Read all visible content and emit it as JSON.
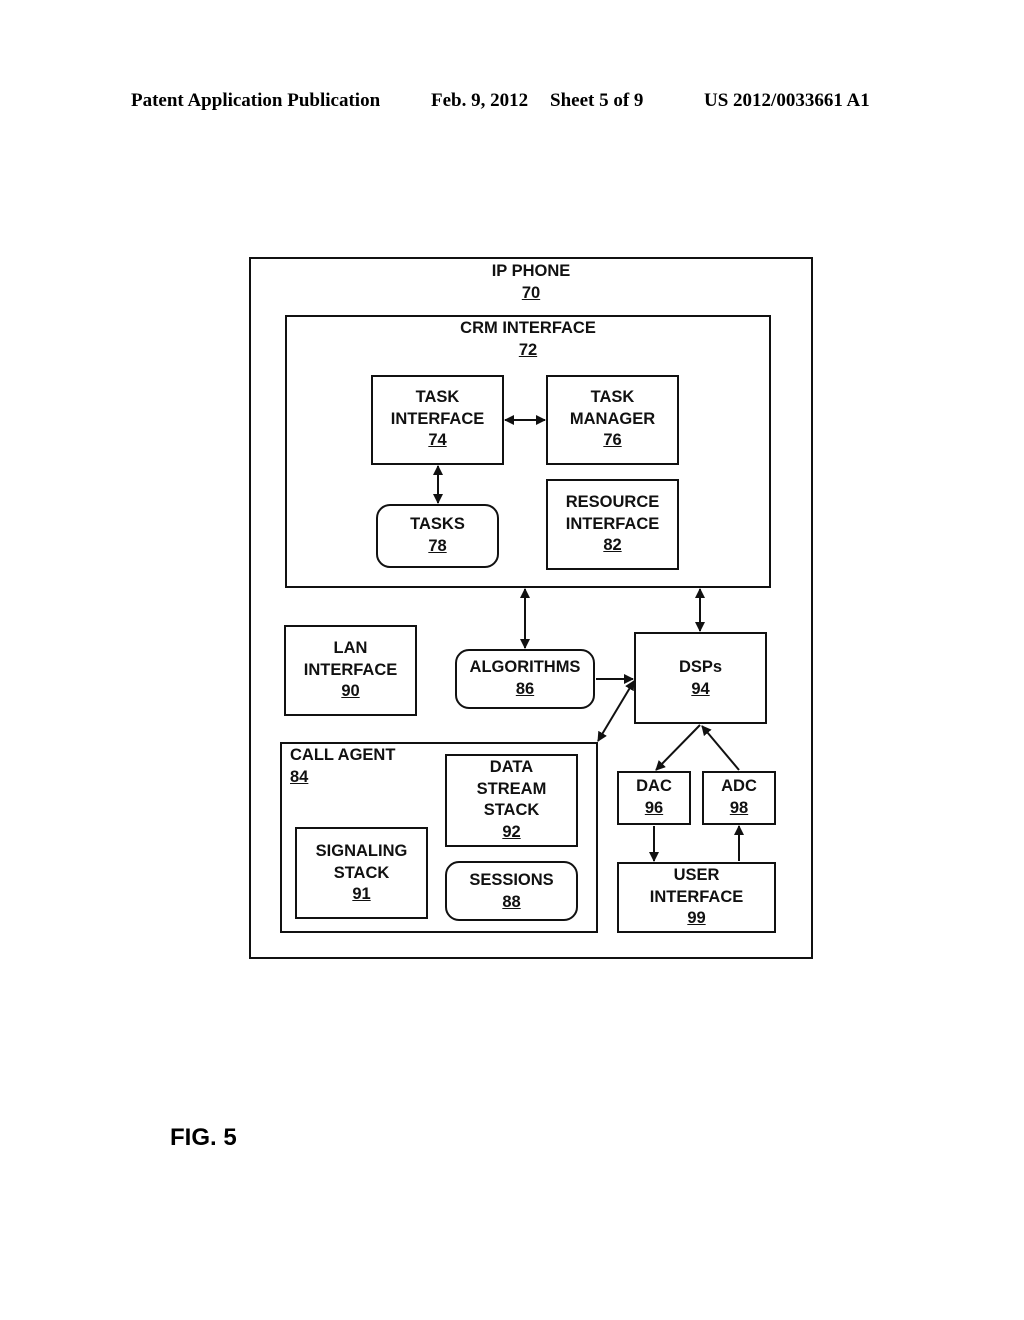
{
  "header": {
    "publication": "Patent Application Publication",
    "date": "Feb. 9, 2012",
    "sheet": "Sheet 5 of 9",
    "number": "US 2012/0033661 A1"
  },
  "figure_label": "FIG. 5",
  "blocks": {
    "ip_phone": {
      "title": "IP PHONE",
      "ref": "70"
    },
    "crm_interface": {
      "title": "CRM INTERFACE",
      "ref": "72"
    },
    "task_interface": {
      "line1": "TASK",
      "line2": "INTERFACE",
      "ref": "74"
    },
    "task_manager": {
      "line1": "TASK",
      "line2": "MANAGER",
      "ref": "76"
    },
    "tasks": {
      "title": "TASKS",
      "ref": "78"
    },
    "resource_interface": {
      "line1": "RESOURCE",
      "line2": "INTERFACE",
      "ref": "82"
    },
    "lan_interface": {
      "line1": "LAN",
      "line2": "INTERFACE",
      "ref": "90"
    },
    "algorithms": {
      "title": "ALGORITHMS",
      "ref": "86"
    },
    "dsps": {
      "title": "DSPs",
      "ref": "94"
    },
    "call_agent": {
      "title": "CALL AGENT",
      "ref": "84"
    },
    "data_stream_stack": {
      "line1": "DATA",
      "line2": "STREAM",
      "line3": "STACK",
      "ref": "92"
    },
    "signaling_stack": {
      "line1": "SIGNALING",
      "line2": "STACK",
      "ref": "91"
    },
    "sessions": {
      "title": "SESSIONS",
      "ref": "88"
    },
    "dac": {
      "title": "DAC",
      "ref": "96"
    },
    "adc": {
      "title": "ADC",
      "ref": "98"
    },
    "user_interface": {
      "line1": "USER",
      "line2": "INTERFACE",
      "ref": "99"
    }
  },
  "connections": [
    {
      "from": "task_interface",
      "to": "task_manager",
      "type": "bidirectional"
    },
    {
      "from": "task_interface",
      "to": "tasks",
      "type": "bidirectional"
    },
    {
      "from": "crm_interface",
      "to": "algorithms",
      "type": "bidirectional"
    },
    {
      "from": "crm_interface",
      "to": "dsps",
      "type": "bidirectional"
    },
    {
      "from": "algorithms",
      "to": "dsps",
      "type": "directed"
    },
    {
      "from": "call_agent",
      "to": "dsps",
      "type": "bidirectional"
    },
    {
      "from": "dsps",
      "to": "dac",
      "type": "directed"
    },
    {
      "from": "adc",
      "to": "dsps",
      "type": "directed"
    },
    {
      "from": "dac",
      "to": "user_interface",
      "type": "directed"
    },
    {
      "from": "user_interface",
      "to": "adc",
      "type": "directed"
    }
  ]
}
